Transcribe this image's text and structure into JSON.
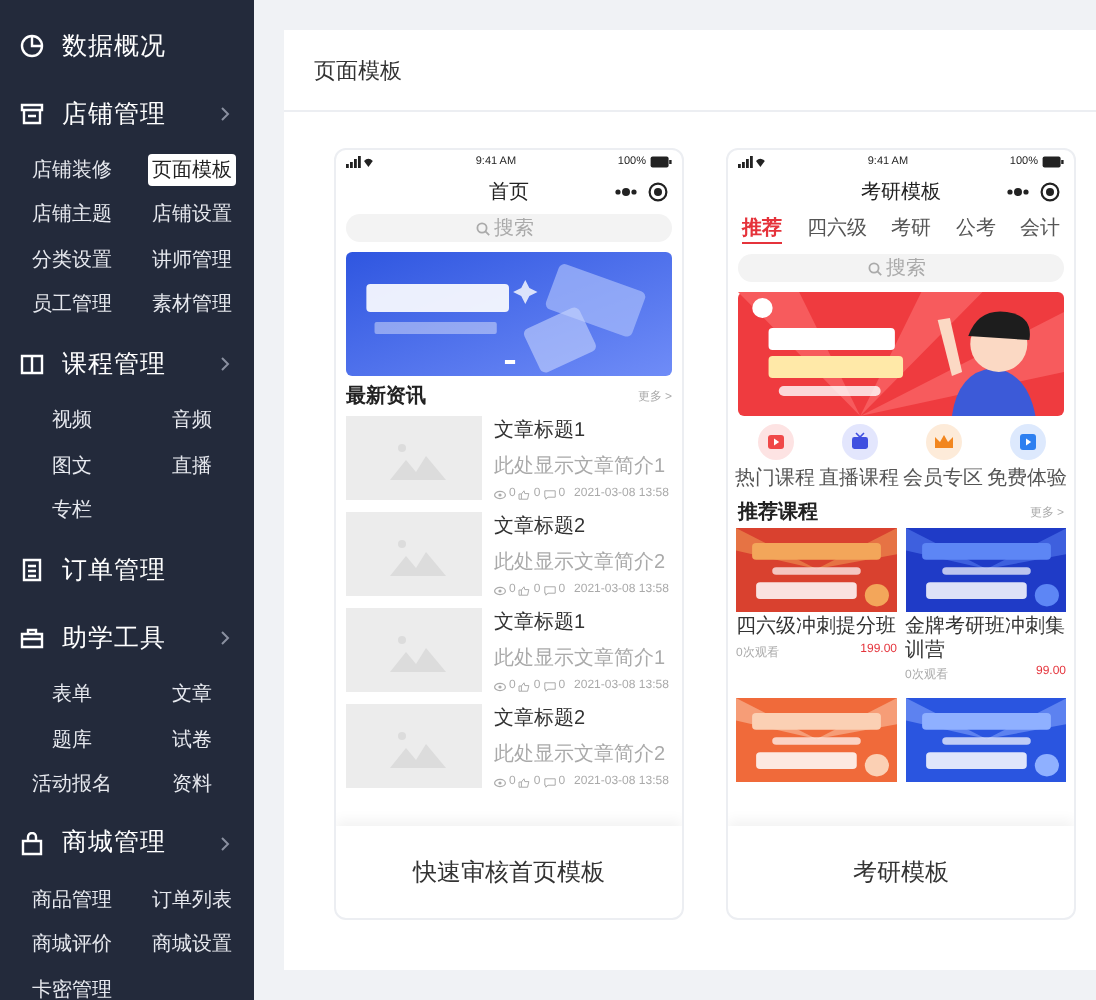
{
  "sidebar": {
    "sections": [
      {
        "title": "数据概况",
        "expandable": false
      },
      {
        "title": "店铺管理",
        "expandable": true,
        "items": [
          {
            "label": "店铺装修",
            "selected": false
          },
          {
            "label": "页面模板",
            "selected": true
          },
          {
            "label": "店铺主题",
            "selected": false
          },
          {
            "label": "店铺设置",
            "selected": false
          },
          {
            "label": "分类设置",
            "selected": false
          },
          {
            "label": "讲师管理",
            "selected": false
          },
          {
            "label": "员工管理",
            "selected": false
          },
          {
            "label": "素材管理",
            "selected": false
          }
        ]
      },
      {
        "title": "课程管理",
        "expandable": true,
        "items": [
          {
            "label": "视频",
            "selected": false
          },
          {
            "label": "音频",
            "selected": false
          },
          {
            "label": "图文",
            "selected": false
          },
          {
            "label": "直播",
            "selected": false
          },
          {
            "label": "专栏",
            "selected": false
          }
        ]
      },
      {
        "title": "订单管理",
        "expandable": false
      },
      {
        "title": "助学工具",
        "expandable": true,
        "items": [
          {
            "label": "表单",
            "selected": false
          },
          {
            "label": "文章",
            "selected": false
          },
          {
            "label": "题库",
            "selected": false
          },
          {
            "label": "试卷",
            "selected": false
          },
          {
            "label": "活动报名",
            "selected": false
          },
          {
            "label": "资料",
            "selected": false
          }
        ]
      },
      {
        "title": "商城管理",
        "expandable": true,
        "items": [
          {
            "label": "商品管理",
            "selected": false
          },
          {
            "label": "订单列表",
            "selected": false
          },
          {
            "label": "商城评价",
            "selected": false
          },
          {
            "label": "商城设置",
            "selected": false
          },
          {
            "label": "卡密管理",
            "selected": false
          }
        ]
      }
    ]
  },
  "panel": {
    "title": "页面模板"
  },
  "templates": [
    {
      "kind": "news",
      "name": "快速审核首页模板",
      "time": "9:41 AM",
      "battery": "100%",
      "title": "首页",
      "search": {
        "placeholder": "搜索"
      },
      "section_title": "最新资讯",
      "more": "更多 >",
      "articles": [
        {
          "title": "文章标题1",
          "summary": "此处显示文章简介1",
          "views": "0",
          "likes": "0",
          "comments": "0",
          "date": "2021-03-08 13:58"
        },
        {
          "title": "文章标题2",
          "summary": "此处显示文章简介2",
          "views": "0",
          "likes": "0",
          "comments": "0",
          "date": "2021-03-08 13:58"
        },
        {
          "title": "文章标题1",
          "summary": "此处显示文章简介1",
          "views": "0",
          "likes": "0",
          "comments": "0",
          "date": "2021-03-08 13:58"
        },
        {
          "title": "文章标题2",
          "summary": "此处显示文章简介2",
          "views": "0",
          "likes": "0",
          "comments": "0",
          "date": "2021-03-08 13:58"
        }
      ]
    },
    {
      "kind": "exam",
      "name": "考研模板",
      "time": "9:41 AM",
      "battery": "100%",
      "title": "考研模板",
      "tabs": [
        {
          "label": "推荐",
          "selected": true
        },
        {
          "label": "四六级",
          "selected": false
        },
        {
          "label": "考研",
          "selected": false
        },
        {
          "label": "公考",
          "selected": false
        },
        {
          "label": "会计",
          "selected": false
        }
      ],
      "search": {
        "placeholder": "搜索"
      },
      "quick_links": [
        {
          "label": "热门课程"
        },
        {
          "label": "直播课程"
        },
        {
          "label": "会员专区"
        },
        {
          "label": "免费体验"
        }
      ],
      "section_title": "推荐课程",
      "more": "更多 >",
      "courses": [
        {
          "title": "四六级冲刺提分班",
          "views": "0次观看",
          "price": "199.00"
        },
        {
          "title": "金牌考研班冲刺集训营",
          "views": "0次观看",
          "price": "99.00"
        }
      ]
    }
  ]
}
